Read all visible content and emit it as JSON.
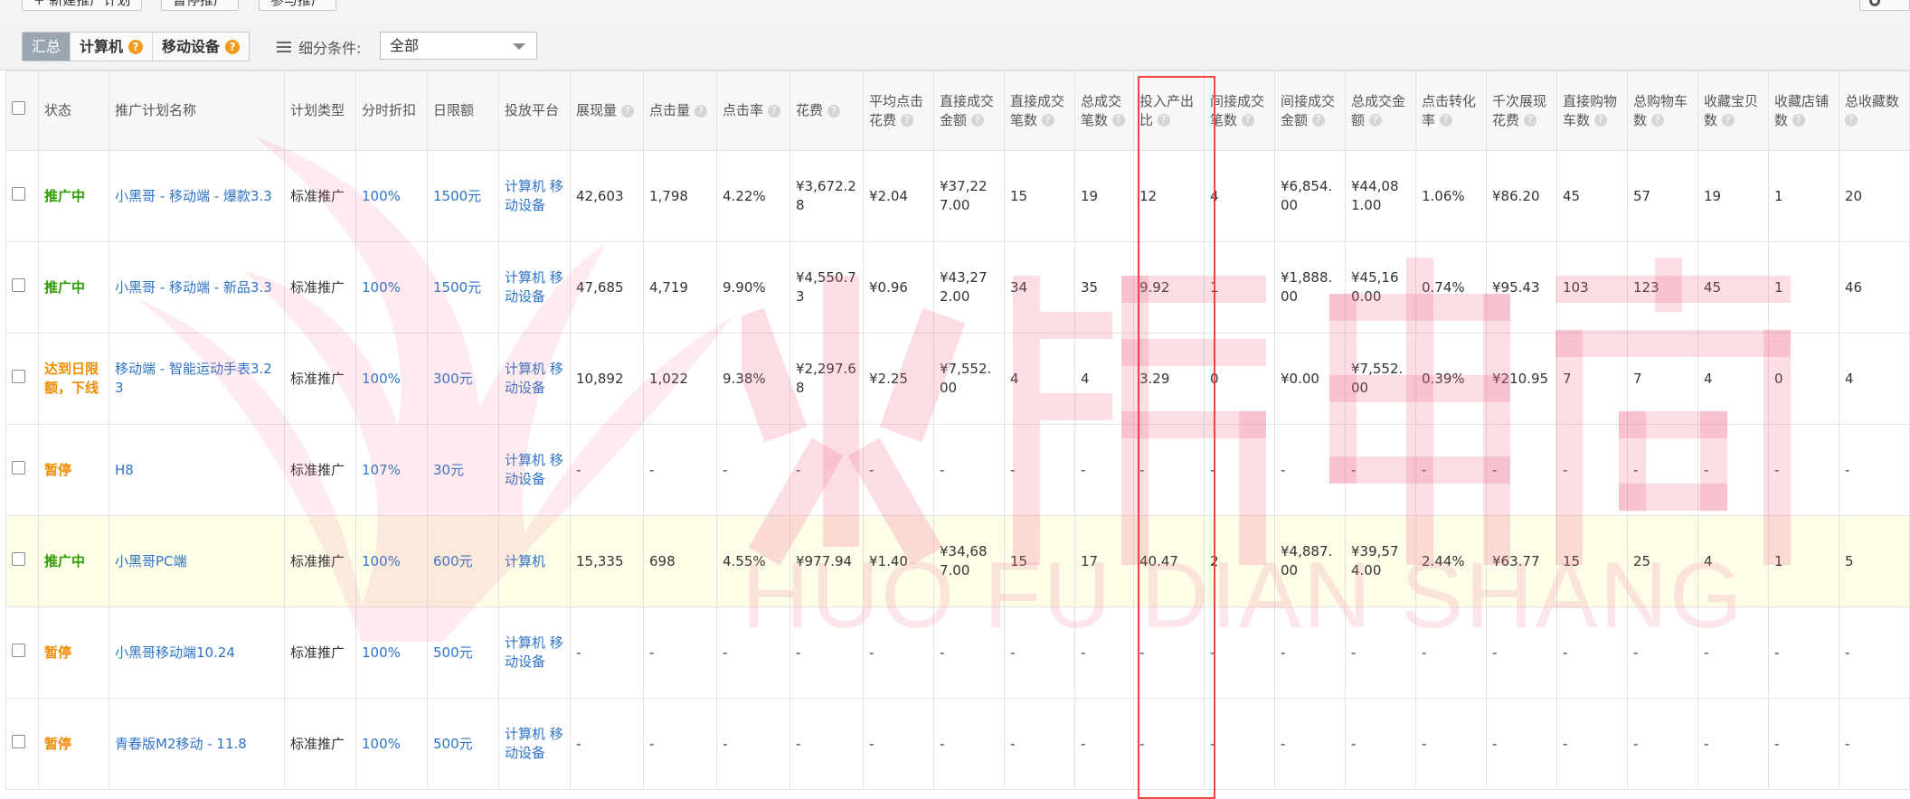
{
  "toolbar": {
    "buttons": [
      "+ 新建推广计划",
      "暂停推广",
      "参与推广"
    ]
  },
  "filter": {
    "segments": [
      {
        "label": "汇总",
        "active": true,
        "help": false
      },
      {
        "label": "计算机",
        "active": false,
        "help": true
      },
      {
        "label": "移动设备",
        "active": false,
        "help": true
      }
    ],
    "sub_label": "细分条件:",
    "select_value": "全部"
  },
  "table": {
    "columns": [
      {
        "label": "",
        "help": false
      },
      {
        "label": "状态",
        "help": false
      },
      {
        "label": "推广计划名称",
        "help": false
      },
      {
        "label": "计划类型",
        "help": false
      },
      {
        "label": "分时折扣",
        "help": false
      },
      {
        "label": "日限额",
        "help": false
      },
      {
        "label": "投放平台",
        "help": false
      },
      {
        "label": "展现量",
        "help": true
      },
      {
        "label": "点击量",
        "help": true
      },
      {
        "label": "点击率",
        "help": true
      },
      {
        "label": "花费",
        "help": true
      },
      {
        "label": "平均点击花费",
        "help": true
      },
      {
        "label": "直接成交金额",
        "help": true
      },
      {
        "label": "直接成交笔数",
        "help": true
      },
      {
        "label": "总成交笔数",
        "help": true
      },
      {
        "label": "投入产出比",
        "help": true
      },
      {
        "label": "间接成交笔数",
        "help": true
      },
      {
        "label": "间接成交金额",
        "help": true
      },
      {
        "label": "总成交金额",
        "help": true
      },
      {
        "label": "点击转化率",
        "help": true
      },
      {
        "label": "千次展现花费",
        "help": true
      },
      {
        "label": "直接购物车数",
        "help": true
      },
      {
        "label": "总购物车数",
        "help": true
      },
      {
        "label": "收藏宝贝数",
        "help": true
      },
      {
        "label": "收藏店铺数",
        "help": true
      },
      {
        "label": "总收藏数",
        "help": true
      }
    ],
    "rows": [
      {
        "status": "推广中",
        "status_color": "green",
        "highlight": false,
        "name": "小黑哥 - 移动端 - 爆款3.3",
        "type": "标准推广",
        "discount": "100%",
        "limit": "1500元",
        "platform": "计算机 移动设备",
        "cells": [
          "42,603",
          "1,798",
          "4.22%",
          "¥3,672.28",
          "¥2.04",
          "¥37,227.00",
          "15",
          "19",
          "12",
          "4",
          "¥6,854.00",
          "¥44,081.00",
          "1.06%",
          "¥86.20",
          "45",
          "57",
          "19",
          "1",
          "20"
        ]
      },
      {
        "status": "推广中",
        "status_color": "green",
        "highlight": false,
        "name": "小黑哥 - 移动端 - 新品3.3",
        "type": "标准推广",
        "discount": "100%",
        "limit": "1500元",
        "platform": "计算机 移动设备",
        "cells": [
          "47,685",
          "4,719",
          "9.90%",
          "¥4,550.73",
          "¥0.96",
          "¥43,272.00",
          "34",
          "35",
          "9.92",
          "1",
          "¥1,888.00",
          "¥45,160.00",
          "0.74%",
          "¥95.43",
          "103",
          "123",
          "45",
          "1",
          "46"
        ]
      },
      {
        "status": "达到日限额，下线",
        "status_color": "orange",
        "highlight": false,
        "name": "移动端 - 智能运动手表3.23",
        "type": "标准推广",
        "discount": "100%",
        "limit": "300元",
        "platform": "计算机 移动设备",
        "cells": [
          "10,892",
          "1,022",
          "9.38%",
          "¥2,297.68",
          "¥2.25",
          "¥7,552.00",
          "4",
          "4",
          "3.29",
          "0",
          "¥0.00",
          "¥7,552.00",
          "0.39%",
          "¥210.95",
          "7",
          "7",
          "4",
          "0",
          "4"
        ]
      },
      {
        "status": "暂停",
        "status_color": "orange",
        "highlight": false,
        "name": "H8",
        "type": "标准推广",
        "discount": "107%",
        "limit": "30元",
        "platform": "计算机 移动设备",
        "cells": [
          "-",
          "-",
          "-",
          "-",
          "-",
          "-",
          "-",
          "-",
          "-",
          "-",
          "-",
          "-",
          "-",
          "-",
          "-",
          "-",
          "-",
          "-",
          "-"
        ]
      },
      {
        "status": "推广中",
        "status_color": "green",
        "highlight": true,
        "name": "小黑哥PC端",
        "type": "标准推广",
        "discount": "100%",
        "limit": "600元",
        "platform": "计算机",
        "cells": [
          "15,335",
          "698",
          "4.55%",
          "¥977.94",
          "¥1.40",
          "¥34,687.00",
          "15",
          "17",
          "40.47",
          "2",
          "¥4,887.00",
          "¥39,574.00",
          "2.44%",
          "¥63.77",
          "15",
          "25",
          "4",
          "1",
          "5"
        ]
      },
      {
        "status": "暂停",
        "status_color": "orange",
        "highlight": false,
        "name": "小黑哥移动端10.24",
        "type": "标准推广",
        "discount": "100%",
        "limit": "500元",
        "platform": "计算机 移动设备",
        "cells": [
          "-",
          "-",
          "-",
          "-",
          "-",
          "-",
          "-",
          "-",
          "-",
          "-",
          "-",
          "-",
          "-",
          "-",
          "-",
          "-",
          "-",
          "-",
          "-"
        ]
      },
      {
        "status": "暂停",
        "status_color": "orange",
        "highlight": false,
        "name": "青春版M2移动 - 11.8",
        "type": "标准推广",
        "discount": "100%",
        "limit": "500元",
        "platform": "计算机 移动设备",
        "cells": [
          "-",
          "-",
          "-",
          "-",
          "-",
          "-",
          "-",
          "-",
          "-",
          "-",
          "-",
          "-",
          "-",
          "-",
          "-",
          "-",
          "-",
          "-",
          "-"
        ]
      }
    ]
  },
  "watermark": {
    "text_cn": "火蝠电商",
    "text_en": "HUO FU DIAN SHANG"
  },
  "colors": {
    "status_green": "#2d9c00",
    "status_orange": "#f08c00",
    "link_blue": "#2e73c9",
    "highlight_row": "#fdfde8",
    "highlight_box": "#e44444",
    "watermark": "#f08ca0"
  },
  "icons": {
    "help": "question-circle-icon",
    "checkbox": "checkbox-icon",
    "list": "list-icon",
    "dropdown": "chevron-down-icon",
    "settings": "gear-icon"
  }
}
